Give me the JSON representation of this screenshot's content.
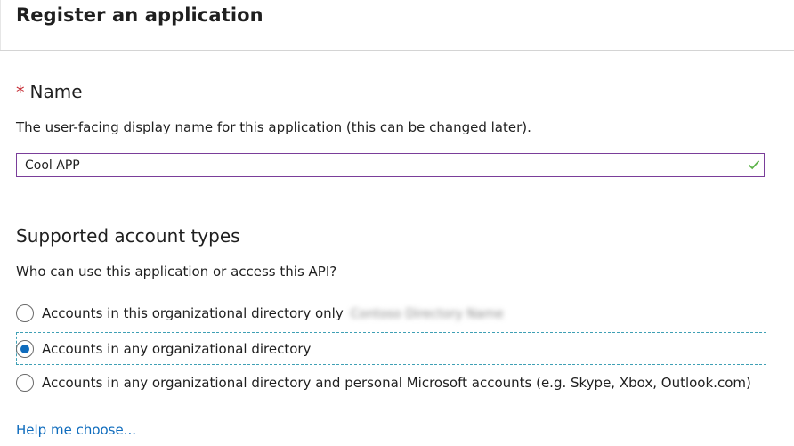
{
  "header": {
    "title": "Register an application"
  },
  "name_section": {
    "required_marker": "*",
    "title": "Name",
    "description": "The user-facing display name for this application (this can be changed later).",
    "input_value": "Cool APP",
    "valid_icon": "checkmark-icon",
    "valid_color": "#5db34a",
    "focus_border_color": "#7a3e9a"
  },
  "accounts_section": {
    "title": "Supported account types",
    "description": "Who can use this application or access this API?",
    "options": [
      {
        "label": "Accounts in this organizational directory only",
        "redacted_suffix": "(redacted)",
        "selected": false
      },
      {
        "label": "Accounts in any organizational directory",
        "selected": true
      },
      {
        "label": "Accounts in any organizational directory and personal Microsoft accounts (e.g. Skype, Xbox, Outlook.com)",
        "selected": false
      }
    ],
    "selected_color": "#0f6cbd"
  },
  "help_link": {
    "label": "Help me choose..."
  }
}
